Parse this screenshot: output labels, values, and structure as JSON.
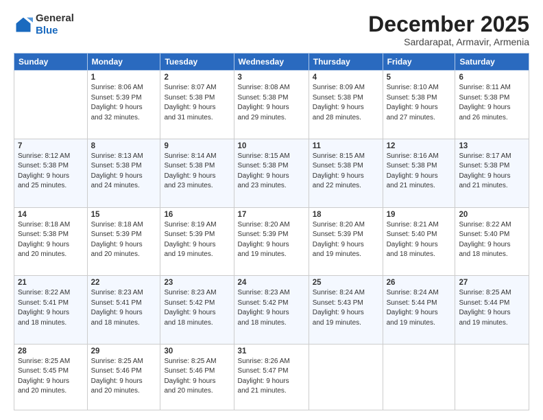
{
  "header": {
    "logo": {
      "line1": "General",
      "line2": "Blue"
    },
    "title": "December 2025",
    "subtitle": "Sardarapat, Armavir, Armenia"
  },
  "calendar": {
    "weekdays": [
      "Sunday",
      "Monday",
      "Tuesday",
      "Wednesday",
      "Thursday",
      "Friday",
      "Saturday"
    ],
    "weeks": [
      [
        {
          "day": "",
          "info": ""
        },
        {
          "day": "1",
          "info": "Sunrise: 8:06 AM\nSunset: 5:39 PM\nDaylight: 9 hours\nand 32 minutes."
        },
        {
          "day": "2",
          "info": "Sunrise: 8:07 AM\nSunset: 5:38 PM\nDaylight: 9 hours\nand 31 minutes."
        },
        {
          "day": "3",
          "info": "Sunrise: 8:08 AM\nSunset: 5:38 PM\nDaylight: 9 hours\nand 29 minutes."
        },
        {
          "day": "4",
          "info": "Sunrise: 8:09 AM\nSunset: 5:38 PM\nDaylight: 9 hours\nand 28 minutes."
        },
        {
          "day": "5",
          "info": "Sunrise: 8:10 AM\nSunset: 5:38 PM\nDaylight: 9 hours\nand 27 minutes."
        },
        {
          "day": "6",
          "info": "Sunrise: 8:11 AM\nSunset: 5:38 PM\nDaylight: 9 hours\nand 26 minutes."
        }
      ],
      [
        {
          "day": "7",
          "info": "Sunrise: 8:12 AM\nSunset: 5:38 PM\nDaylight: 9 hours\nand 25 minutes."
        },
        {
          "day": "8",
          "info": "Sunrise: 8:13 AM\nSunset: 5:38 PM\nDaylight: 9 hours\nand 24 minutes."
        },
        {
          "day": "9",
          "info": "Sunrise: 8:14 AM\nSunset: 5:38 PM\nDaylight: 9 hours\nand 23 minutes."
        },
        {
          "day": "10",
          "info": "Sunrise: 8:15 AM\nSunset: 5:38 PM\nDaylight: 9 hours\nand 23 minutes."
        },
        {
          "day": "11",
          "info": "Sunrise: 8:15 AM\nSunset: 5:38 PM\nDaylight: 9 hours\nand 22 minutes."
        },
        {
          "day": "12",
          "info": "Sunrise: 8:16 AM\nSunset: 5:38 PM\nDaylight: 9 hours\nand 21 minutes."
        },
        {
          "day": "13",
          "info": "Sunrise: 8:17 AM\nSunset: 5:38 PM\nDaylight: 9 hours\nand 21 minutes."
        }
      ],
      [
        {
          "day": "14",
          "info": "Sunrise: 8:18 AM\nSunset: 5:38 PM\nDaylight: 9 hours\nand 20 minutes."
        },
        {
          "day": "15",
          "info": "Sunrise: 8:18 AM\nSunset: 5:39 PM\nDaylight: 9 hours\nand 20 minutes."
        },
        {
          "day": "16",
          "info": "Sunrise: 8:19 AM\nSunset: 5:39 PM\nDaylight: 9 hours\nand 19 minutes."
        },
        {
          "day": "17",
          "info": "Sunrise: 8:20 AM\nSunset: 5:39 PM\nDaylight: 9 hours\nand 19 minutes."
        },
        {
          "day": "18",
          "info": "Sunrise: 8:20 AM\nSunset: 5:39 PM\nDaylight: 9 hours\nand 19 minutes."
        },
        {
          "day": "19",
          "info": "Sunrise: 8:21 AM\nSunset: 5:40 PM\nDaylight: 9 hours\nand 18 minutes."
        },
        {
          "day": "20",
          "info": "Sunrise: 8:22 AM\nSunset: 5:40 PM\nDaylight: 9 hours\nand 18 minutes."
        }
      ],
      [
        {
          "day": "21",
          "info": "Sunrise: 8:22 AM\nSunset: 5:41 PM\nDaylight: 9 hours\nand 18 minutes."
        },
        {
          "day": "22",
          "info": "Sunrise: 8:23 AM\nSunset: 5:41 PM\nDaylight: 9 hours\nand 18 minutes."
        },
        {
          "day": "23",
          "info": "Sunrise: 8:23 AM\nSunset: 5:42 PM\nDaylight: 9 hours\nand 18 minutes."
        },
        {
          "day": "24",
          "info": "Sunrise: 8:23 AM\nSunset: 5:42 PM\nDaylight: 9 hours\nand 18 minutes."
        },
        {
          "day": "25",
          "info": "Sunrise: 8:24 AM\nSunset: 5:43 PM\nDaylight: 9 hours\nand 19 minutes."
        },
        {
          "day": "26",
          "info": "Sunrise: 8:24 AM\nSunset: 5:44 PM\nDaylight: 9 hours\nand 19 minutes."
        },
        {
          "day": "27",
          "info": "Sunrise: 8:25 AM\nSunset: 5:44 PM\nDaylight: 9 hours\nand 19 minutes."
        }
      ],
      [
        {
          "day": "28",
          "info": "Sunrise: 8:25 AM\nSunset: 5:45 PM\nDaylight: 9 hours\nand 20 minutes."
        },
        {
          "day": "29",
          "info": "Sunrise: 8:25 AM\nSunset: 5:46 PM\nDaylight: 9 hours\nand 20 minutes."
        },
        {
          "day": "30",
          "info": "Sunrise: 8:25 AM\nSunset: 5:46 PM\nDaylight: 9 hours\nand 20 minutes."
        },
        {
          "day": "31",
          "info": "Sunrise: 8:26 AM\nSunset: 5:47 PM\nDaylight: 9 hours\nand 21 minutes."
        },
        {
          "day": "",
          "info": ""
        },
        {
          "day": "",
          "info": ""
        },
        {
          "day": "",
          "info": ""
        }
      ]
    ]
  }
}
